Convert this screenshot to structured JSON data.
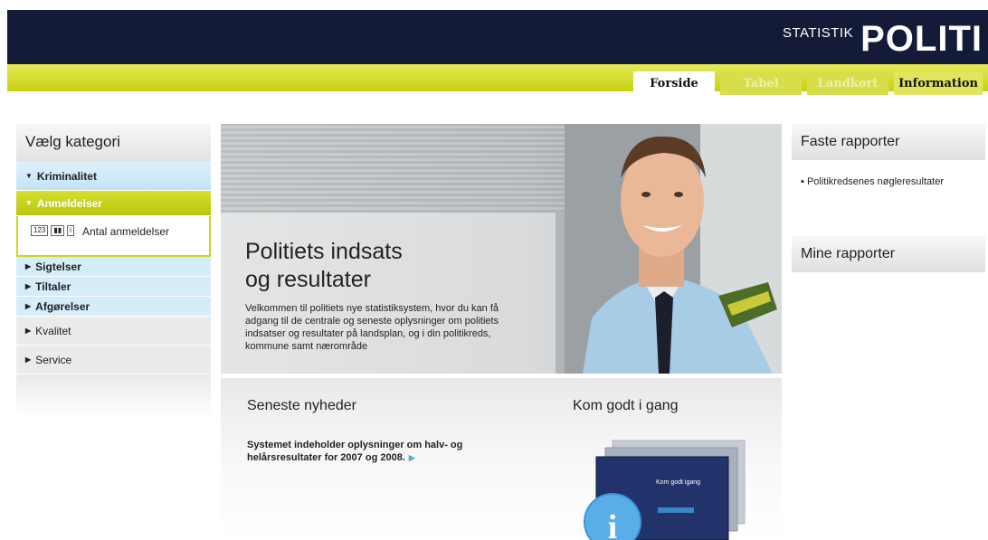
{
  "header": {
    "brand_small": "STATISTIK",
    "brand_big": "POLITI",
    "tabs": [
      {
        "label": "Forside",
        "state": "active"
      },
      {
        "label": "Tabel",
        "state": "disabled"
      },
      {
        "label": "Landkort",
        "state": "disabled"
      },
      {
        "label": "Information",
        "state": "normal"
      }
    ]
  },
  "sidebar": {
    "title": "Vælg kategori",
    "categories": [
      {
        "label": "Kriminalitet",
        "expanded": true
      },
      {
        "label": "Anmeldelser",
        "expanded": true
      },
      {
        "label": "Sigtelser",
        "expanded": false
      },
      {
        "label": "Tiltaler",
        "expanded": false
      },
      {
        "label": "Afgørelser",
        "expanded": false
      },
      {
        "label": "Kvalitet",
        "expanded": false
      },
      {
        "label": "Service",
        "expanded": false
      }
    ],
    "panel": {
      "icon1": "123",
      "icon2": "chart-icon",
      "icon3": "i",
      "label": "Antal anmeldelser"
    }
  },
  "hero": {
    "title_line1": "Politiets indsats",
    "title_line2": "og resultater",
    "body": "Velkommen til politiets nye statistiksystem, hvor du kan få adgang til de centrale og seneste oplysninger om politiets indsatser og resultater på landsplan, og i din politikreds, kommune samt nærområde"
  },
  "news": {
    "title": "Seneste nyheder",
    "text": "Systemet indeholder oplysninger om halv- og helårsresultater for 2007 og 2008."
  },
  "start": {
    "title": "Kom godt i gang",
    "thumb_text": "Kom godt igang"
  },
  "right": {
    "faste_title": "Faste rapporter",
    "faste_item": "Politikredsenes nøgleresultater",
    "mine_title": "Mine rapporter"
  },
  "colors": {
    "header_bg": "#141b38",
    "accent_green": "#cdd615",
    "light_blue": "#d5ecf9"
  }
}
